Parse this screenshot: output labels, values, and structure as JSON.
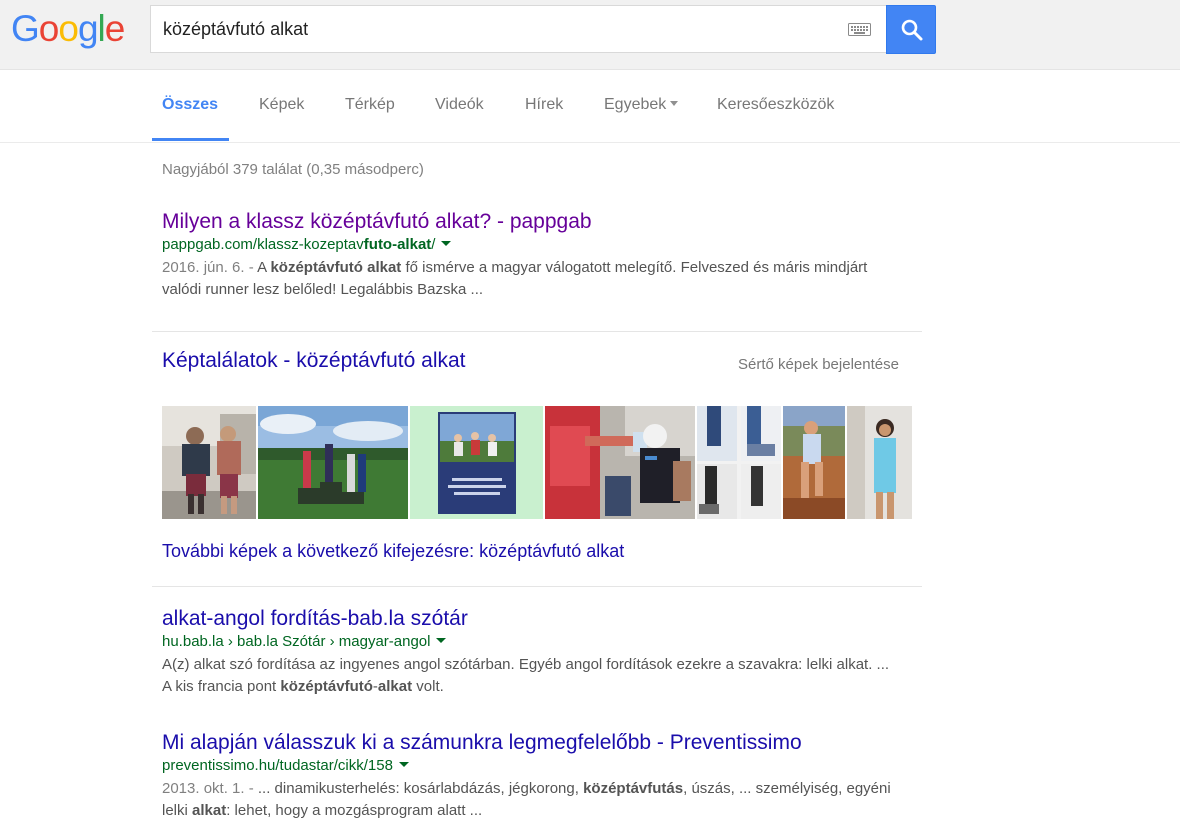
{
  "header": {
    "logo_text": "Google",
    "search": {
      "value": "középtávfutó alkat"
    },
    "keyboard_icon": "keyboard-icon",
    "search_icon": "search-icon"
  },
  "tabs": [
    {
      "label": "Összes",
      "active": true
    },
    {
      "label": "Képek"
    },
    {
      "label": "Térkép"
    },
    {
      "label": "Videók"
    },
    {
      "label": "Hírek"
    },
    {
      "label": "Egyebek"
    },
    {
      "label": "Keresőeszközök"
    }
  ],
  "stats": "Nagyjából 379 találat (0,35 másodperc)",
  "results": [
    {
      "title": "Milyen a klassz középtávfutó alkat? - pappgab",
      "url_pre": "pappgab.com/klassz-kozeptav",
      "url_bold": "futo-alkat",
      "url_post": "/",
      "date": "2016. jún. 6. - ",
      "s1": "A ",
      "b1": "középtávfutó alkat",
      "s2": " fő ismérve a magyar válogatott melegítő. Felveszed és máris mindjárt valódi runner lesz belőled! Legalábbis Bazska ..."
    },
    {
      "title": "alkat-angol fordítás-bab.la szótár",
      "url": "hu.bab.la › bab.la Szótár › magyar-angol",
      "s1": "A(z) alkat szó fordítása az ingyenes angol szótárban. Egyéb angol fordítások ezekre a szavakra: lelki alkat. ... A kis francia pont ",
      "b1": "középtávfutó",
      "s2": "-",
      "b2": "alkat",
      "s3": " volt."
    },
    {
      "title": "Mi alapján válasszuk ki a számunkra legmegfelelőbb - Preventissimo",
      "url": "preventissimo.hu/tudastar/cikk/158",
      "date": "2013. okt. 1. - ",
      "s1": "... dinamikusterhelés: kosárlabdázás, jégkorong, ",
      "b1": "középtávfutás",
      "s2": ", úszás, ... személyiség, egyéni lelki ",
      "b2": "alkat",
      "s3": ": lehet, hogy a mozgásprogram alatt ..."
    }
  ],
  "images": {
    "heading": "Képtalálatok - középtávfutó alkat",
    "report": "Sértő képek bejelentése",
    "thumbs": [
      {
        "desc": "two-men-standing-photo"
      },
      {
        "desc": "podium-athletes-photo"
      },
      {
        "desc": "book-cover-runners-photo"
      },
      {
        "desc": "runner-water-handoff-photo"
      },
      {
        "desc": "legs-shoes-collage-photo"
      },
      {
        "desc": "woman-running-outdoors-photo"
      },
      {
        "desc": "woman-blue-dress-photo"
      }
    ],
    "more": "További képek a következő kifejezésre: középtávfutó alkat"
  }
}
